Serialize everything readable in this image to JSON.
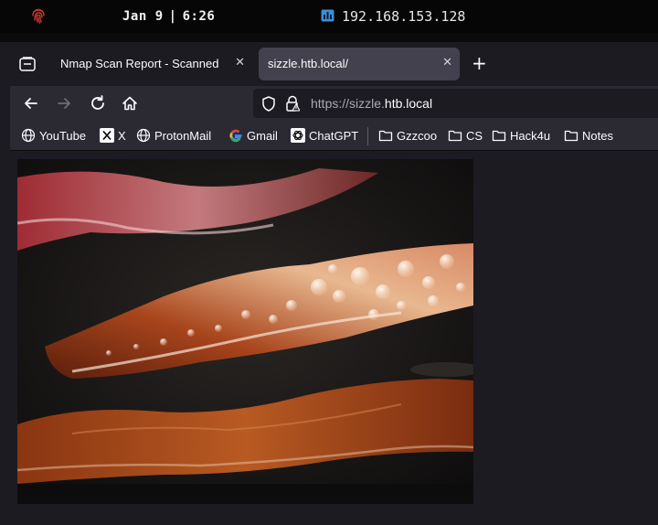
{
  "system_bar": {
    "date": "Jan 9",
    "time": "6:26",
    "ip": "192.168.153.128"
  },
  "tabs": [
    {
      "title": "Nmap Scan Report - Scanned",
      "active": false
    },
    {
      "title": "sizzle.htb.local/",
      "active": true
    }
  ],
  "nav": {
    "url_prefix": "https://sizzle.",
    "url_domain": "htb.local"
  },
  "bookmarks": [
    {
      "label": "YouTube",
      "icon": "globe-icon"
    },
    {
      "label": "X",
      "icon": "x-logo-icon"
    },
    {
      "label": "ProtonMail",
      "icon": "globe-icon"
    },
    {
      "label": "Gmail",
      "icon": "google-icon"
    },
    {
      "label": "ChatGPT",
      "icon": "chatgpt-icon"
    },
    {
      "label": "Gzzcoo",
      "icon": "folder-icon"
    },
    {
      "label": "CS",
      "icon": "folder-icon"
    },
    {
      "label": "Hack4u",
      "icon": "folder-icon"
    },
    {
      "label": "Notes",
      "icon": "folder-icon"
    }
  ],
  "colors": {
    "toolbar": "#2b2a33",
    "active_tab": "#42414d",
    "page_bg": "#1c1b22",
    "accent_red": "#c0302a"
  }
}
